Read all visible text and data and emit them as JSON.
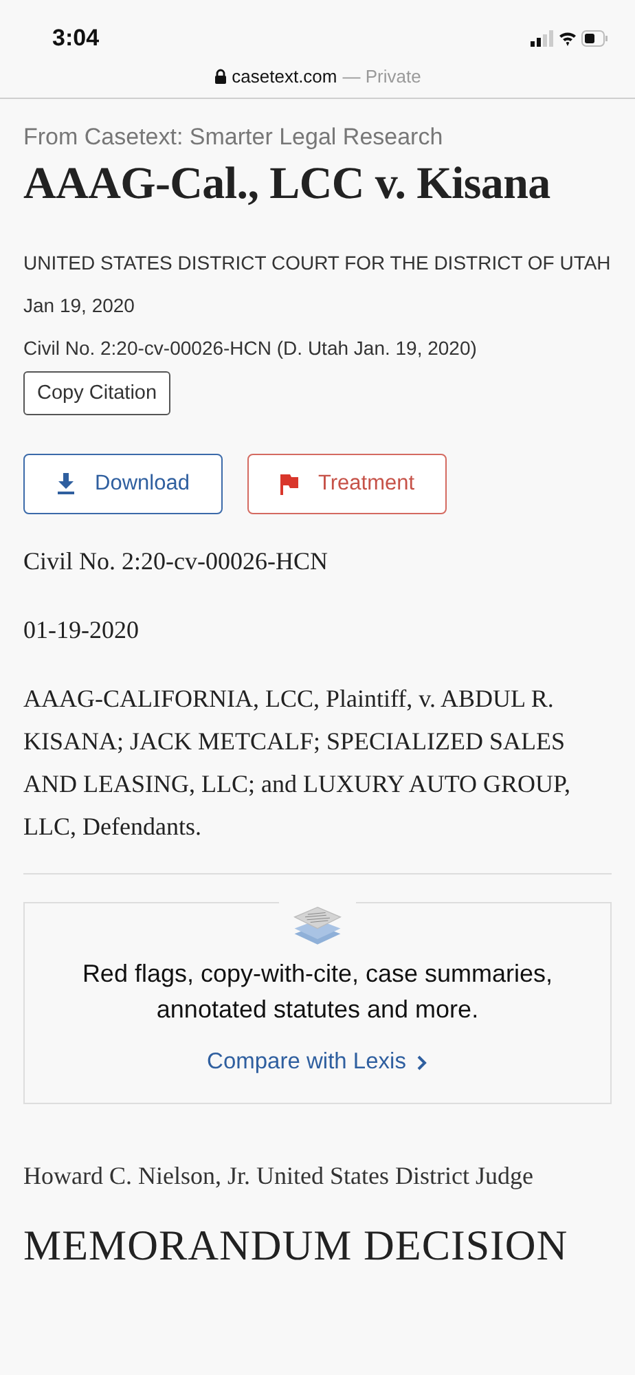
{
  "status_bar": {
    "time": "3:04"
  },
  "address_bar": {
    "domain": "casetext.com",
    "suffix": "— Private"
  },
  "source": "From Casetext: Smarter Legal Research",
  "title": "AAAG-Cal., LCC v. Kisana",
  "court": "UNITED STATES DISTRICT COURT FOR THE DISTRICT OF UTAH",
  "date": "Jan 19, 2020",
  "citation": "Civil No. 2:20-cv-00026-HCN (D. Utah Jan. 19, 2020)",
  "copy_button": "Copy Citation",
  "actions": [
    {
      "kind": "download",
      "label": "Download"
    },
    {
      "kind": "treatment",
      "label": "Treatment"
    }
  ],
  "body_paragraphs": [
    "Civil No. 2:20-cv-00026-HCN",
    "01-19-2020",
    "AAAG-CALIFORNIA, LCC, Plaintiff, v. ABDUL R. KISANA; JACK METCALF; SPECIALIZED SALES AND LEASING, LLC; and LUXURY AUTO GROUP, LLC, Defendants."
  ],
  "promo": {
    "text": "Red flags, copy-with-cite, case summaries, annotated statutes and more.",
    "link": "Compare with Lexis"
  },
  "judge": "Howard C. Nielson, Jr. United States District Judge",
  "heading": "MEMORANDUM DECISION"
}
